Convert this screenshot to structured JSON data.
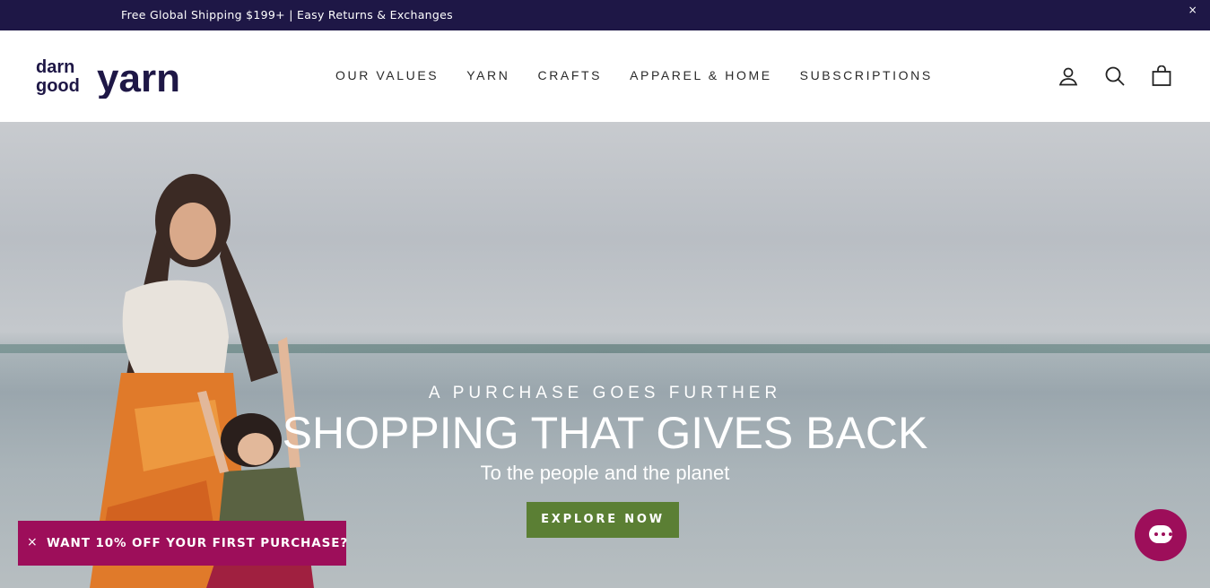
{
  "announcement": {
    "message": "Free Global Shipping $199+ | Easy Returns & Exchanges",
    "close": "×"
  },
  "brand": {
    "line1": "darn",
    "line2": "good",
    "word": "yarn"
  },
  "nav": {
    "items": [
      "OUR VALUES",
      "YARN",
      "CRAFTS",
      "APPAREL & HOME",
      "SUBSCRIPTIONS"
    ]
  },
  "header_icons": [
    "account-icon",
    "search-icon",
    "cart-icon"
  ],
  "hero": {
    "eyebrow": "A PURCHASE GOES FURTHER",
    "headline": "SHOPPING THAT GIVES BACK",
    "subheadline": "To the people and the planet",
    "cta": "EXPLORE NOW"
  },
  "promo": {
    "close": "×",
    "label": "WANT 10% OFF YOUR FIRST PURCHASE?"
  },
  "colors": {
    "announce_bg": "#1e1746",
    "cta_bg": "#5b7f34",
    "promo_bg": "#9d0e5a"
  }
}
